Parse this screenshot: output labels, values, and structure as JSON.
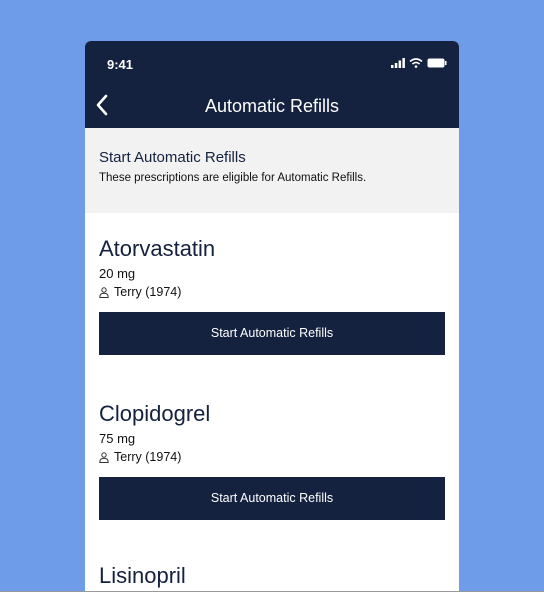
{
  "status": {
    "time": "9:41",
    "icons": [
      "signal-icon",
      "wifi-icon",
      "battery-icon"
    ]
  },
  "nav": {
    "title": "Automatic Refills",
    "back_icon": "chevron-left-icon"
  },
  "banner": {
    "title": "Start Automatic Refills",
    "subtitle": "These prescriptions are eligible for Automatic Refills."
  },
  "prescriptions": [
    {
      "name": "Atorvastatin",
      "dose": "20 mg",
      "patient": "Terry (1974)",
      "button_label": "Start Automatic Refills"
    },
    {
      "name": "Clopidogrel",
      "dose": "75 mg",
      "patient": "Terry (1974)",
      "button_label": "Start Automatic Refills"
    },
    {
      "name": "Lisinopril"
    }
  ],
  "colors": {
    "background": "#6f9ce8",
    "navy": "#14213f",
    "banner": "#f2f2f2"
  }
}
